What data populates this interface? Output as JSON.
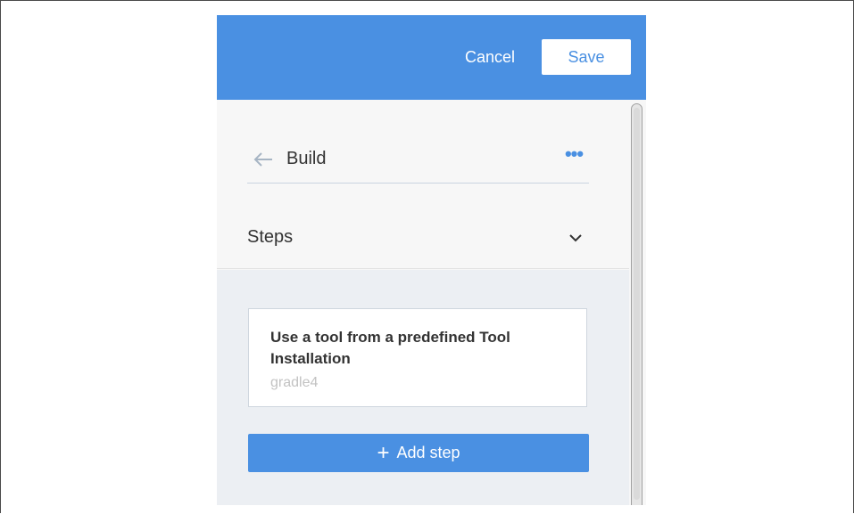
{
  "topbar": {
    "cancel_label": "Cancel",
    "save_label": "Save",
    "color": "#4a90e2"
  },
  "header": {
    "back_icon": "arrow-left-icon",
    "title": "Build",
    "more_icon": "ellipsis-icon",
    "more_glyph": "•••"
  },
  "steps_section": {
    "label": "Steps",
    "toggle_icon": "chevron-down-icon",
    "steps": [
      {
        "title": "Use a tool from a predefined Tool Installation",
        "subtitle": "gradle4"
      }
    ],
    "add_step_label": "Add step",
    "add_icon": "plus-icon"
  }
}
